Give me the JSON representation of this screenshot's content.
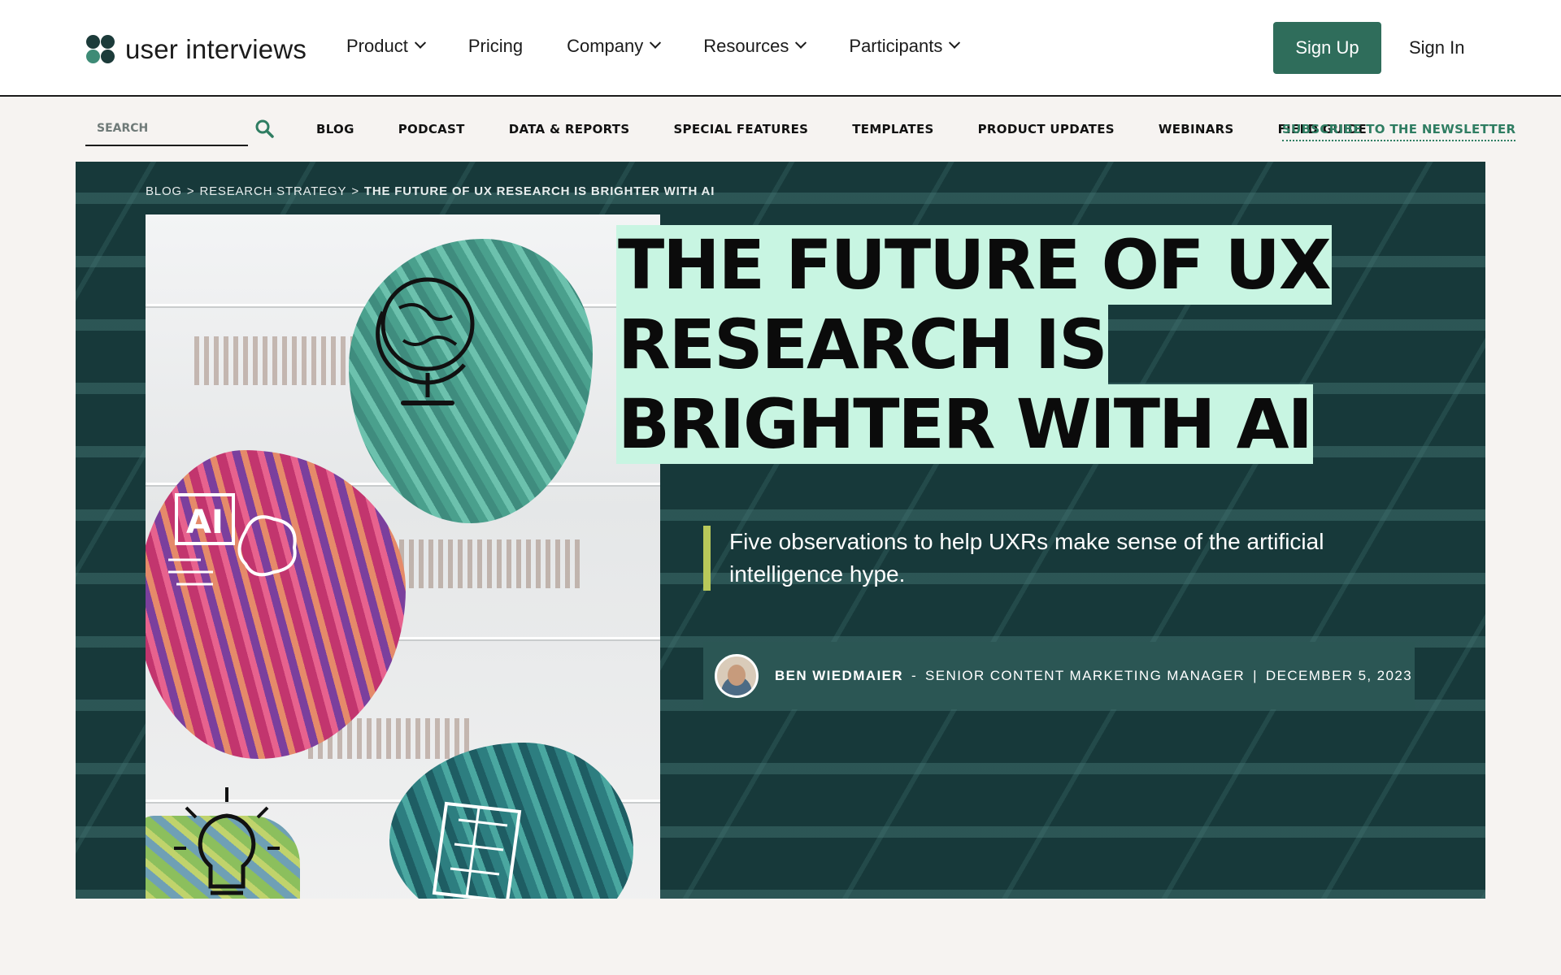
{
  "header": {
    "logo_text": "user interviews",
    "nav": [
      {
        "label": "Product",
        "has_dropdown": true
      },
      {
        "label": "Pricing",
        "has_dropdown": false
      },
      {
        "label": "Company",
        "has_dropdown": true
      },
      {
        "label": "Resources",
        "has_dropdown": true
      },
      {
        "label": "Participants",
        "has_dropdown": true
      }
    ],
    "signup_label": "Sign Up",
    "signin_label": "Sign In",
    "colors": {
      "brand_green": "#2f6d5b"
    }
  },
  "subnav": {
    "search_placeholder": "SEARCH",
    "links": [
      "BLOG",
      "PODCAST",
      "DATA & REPORTS",
      "SPECIAL FEATURES",
      "TEMPLATES",
      "PRODUCT UPDATES",
      "WEBINARS",
      "FIELD GUIDE"
    ],
    "newsletter_label": "SUBSCRIBE TO THE NEWSLETTER"
  },
  "hero": {
    "breadcrumb": {
      "items": [
        "BLOG",
        "RESEARCH STRATEGY"
      ],
      "separator": ">",
      "current": "THE FUTURE OF UX RESEARCH IS BRIGHTER WITH AI"
    },
    "title": "THE FUTURE OF UX RESEARCH IS BRIGHTER WITH AI",
    "subtitle": "Five observations to help UXRs make sense of the artificial intelligence hype.",
    "byline": {
      "author": "BEN WIEDMAIER",
      "dash": "-",
      "role": "SENIOR CONTENT MARKETING MANAGER",
      "divider": "|",
      "date": "DECEMBER 5, 2023"
    },
    "ai_doodle_text": "AI",
    "colors": {
      "background": "#17393a",
      "title_highlight": "#c8f5e2",
      "quote_bar": "#b9c95a",
      "byline_bg": "#2b5654"
    }
  }
}
